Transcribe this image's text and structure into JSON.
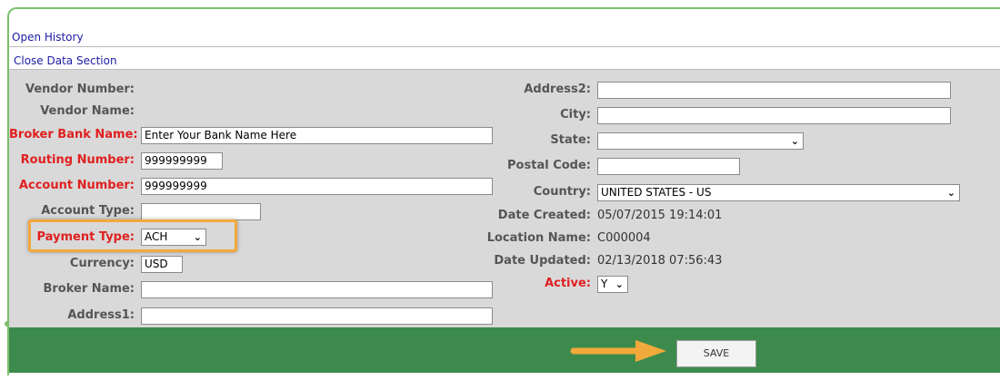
{
  "links": {
    "open_history": "Open History",
    "close_data_section": "Close Data Section"
  },
  "left_form": {
    "vendor_number": {
      "label": "Vendor Number:",
      "value": ""
    },
    "vendor_name": {
      "label": "Vendor Name:",
      "value": ""
    },
    "broker_bank_name": {
      "label": "Broker Bank Name:",
      "value": "Enter Your Bank Name Here"
    },
    "routing_number": {
      "label": "Routing Number:",
      "value": "999999999"
    },
    "account_number": {
      "label": "Account Number:",
      "value": "999999999"
    },
    "account_type": {
      "label": "Account Type:",
      "value": ""
    },
    "payment_type": {
      "label": "Payment Type:",
      "value": "ACH"
    },
    "currency": {
      "label": "Currency:",
      "value": "USD"
    },
    "broker_name": {
      "label": "Broker Name:",
      "value": ""
    },
    "address1": {
      "label": "Address1:",
      "value": ""
    }
  },
  "right_form": {
    "address2": {
      "label": "Address2:",
      "value": ""
    },
    "city": {
      "label": "City:",
      "value": ""
    },
    "state": {
      "label": "State:",
      "value": ""
    },
    "postal_code": {
      "label": "Postal Code:",
      "value": ""
    },
    "country": {
      "label": "Country:",
      "value": "UNITED STATES - US"
    },
    "date_created": {
      "label": "Date Created:",
      "value": "05/07/2015 19:14:01"
    },
    "location_name": {
      "label": "Location Name:",
      "value": "C000004"
    },
    "date_updated": {
      "label": "Date Updated:",
      "value": "02/13/2018 07:56:43"
    },
    "active": {
      "label": "Active:",
      "value": "Y"
    }
  },
  "footer": {
    "save_label": "SAVE"
  },
  "colors": {
    "required_label": "#e02020",
    "label": "#555555",
    "link": "#1a1aa6",
    "panel_bg": "#d9d9d9",
    "footer_bg": "#3d8b4c",
    "highlight": "#f2a93b",
    "frame": "#7bbf6b"
  },
  "icons": {
    "select_chevron": "chevron-down-icon",
    "callout_arrow": "arrow-right-icon"
  }
}
